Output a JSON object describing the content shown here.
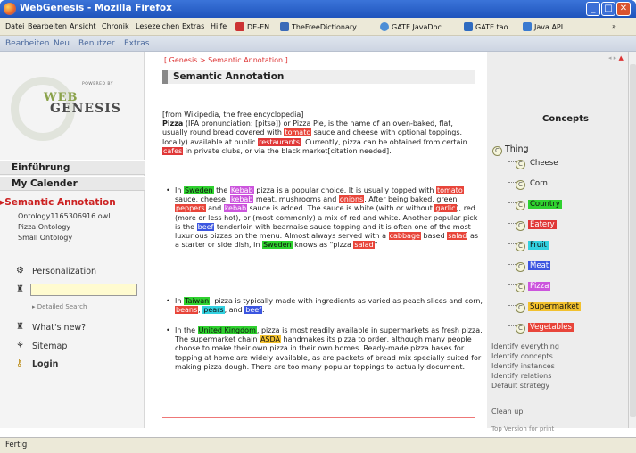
{
  "window": {
    "title": "WebGenesis - Mozilla Firefox"
  },
  "menubar": {
    "items": [
      "Datei",
      "Bearbeiten",
      "Ansicht",
      "Chronik",
      "Lesezeichen",
      "Extras",
      "Hilfe"
    ],
    "bookmarks": [
      "DE-EN",
      "TheFreeDictionary",
      "GATE JavaDoc",
      "GATE tao",
      "Java API"
    ],
    "overflow": "»"
  },
  "wgnav": {
    "items": [
      "Bearbeiten",
      "Neu",
      "Benutzer",
      "Extras"
    ]
  },
  "sidebar": {
    "powered_by": "POWERED BY",
    "logo_line1": "WEB",
    "logo_line2": "GENESIS",
    "nav": [
      "Einführung",
      "My Calender"
    ],
    "active": "Semantic Annotation",
    "sub": [
      "Ontology1165306916.owl",
      "Pizza Ontology",
      "Small Ontology"
    ],
    "personalization": "Personalization",
    "detailed_search": "Detailed Search",
    "whats_new": "What's new?",
    "sitemap": "Sitemap",
    "login": "Login"
  },
  "content": {
    "breadcrumb": "[ Genesis > Semantic Annotation ]",
    "title": "Semantic Annotation",
    "source": "[from Wikipedia, the free encyclopedia]"
  },
  "concepts": {
    "title": "Concepts",
    "root": "Thing",
    "items": [
      {
        "label": "Cheese",
        "color": ""
      },
      {
        "label": "Corn",
        "color": ""
      },
      {
        "label": "Country",
        "color": "#2fd12f"
      },
      {
        "label": "Eatery",
        "color": "#e03838"
      },
      {
        "label": "Fruit",
        "color": "#33d1e0"
      },
      {
        "label": "Meat",
        "color": "#3b55e0"
      },
      {
        "label": "Pizza",
        "color": "#cc55dd"
      },
      {
        "label": "Supermarket",
        "color": "#f2c12e"
      },
      {
        "label": "Vegetables",
        "color": "#e8453a"
      }
    ],
    "actions": [
      "Identify everything",
      "Identify concepts",
      "Identify instances",
      "Identify relations",
      "Default strategy"
    ],
    "clean_up": "Clean up",
    "footer": "Top  Version for print"
  },
  "status": {
    "text": "Fertig"
  }
}
